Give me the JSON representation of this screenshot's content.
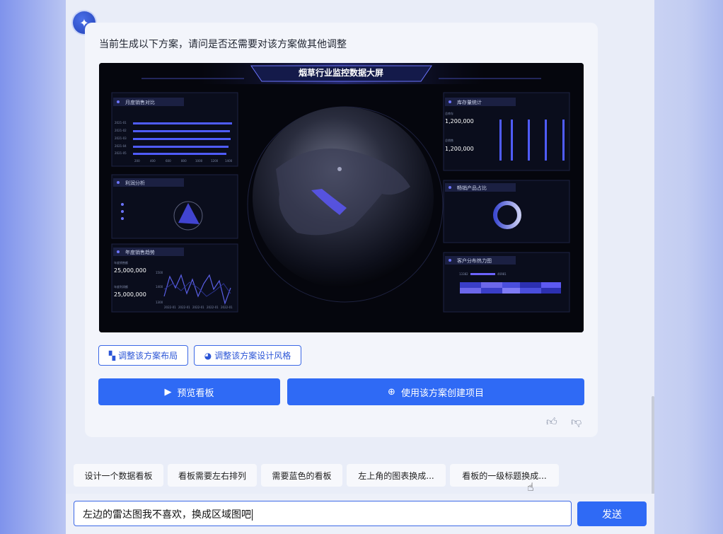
{
  "message": "当前生成以下方案，请问是否还需要对该方案做其他调整",
  "dashboard": {
    "title": "烟草行业监控数据大屏",
    "panels": {
      "monthly": {
        "title": "月度销售对比",
        "years": [
          "2021-01",
          "2021-02",
          "2021-03",
          "2021-04",
          "2021-05"
        ],
        "xticks": [
          "200",
          "400",
          "600",
          "800",
          "1000",
          "1200",
          "1400"
        ]
      },
      "profit": {
        "title": "利润分析"
      },
      "annual": {
        "title": "年度销售趋势",
        "label1": "年度销售额",
        "value1": "25,000,000",
        "label2": "年度利润额",
        "value2": "25,000,000",
        "yticks": [
          "1500",
          "1400",
          "1300"
        ],
        "xticks": [
          "2022-01",
          "2022-01",
          "2022-01",
          "2022-01",
          "2022-01"
        ]
      },
      "inventory": {
        "title": "库存量统计",
        "label1": "总库存",
        "value1": "1,200,000",
        "label2": "总销售",
        "value2": "1,200,000"
      },
      "hotproduct": {
        "title": "畅销产品占比"
      },
      "heatmap": {
        "title": "客户分布热力图",
        "range_low": "13382",
        "range_high": "46981"
      }
    }
  },
  "buttons": {
    "adjust_layout": "调整该方案布局",
    "adjust_style": "调整该方案设计风格",
    "preview": "预览看板",
    "create": "使用该方案创建项目"
  },
  "suggestions": [
    "设计一个数据看板",
    "看板需要左右排列",
    "需要蓝色的看板",
    "左上角的图表换成...",
    "看板的一级标题换成..."
  ],
  "input_value": "左边的雷达图我不喜欢，换成区域图吧",
  "send_label": "发送",
  "colors": {
    "primary": "#2f6af5",
    "accent": "#6c63ff"
  }
}
